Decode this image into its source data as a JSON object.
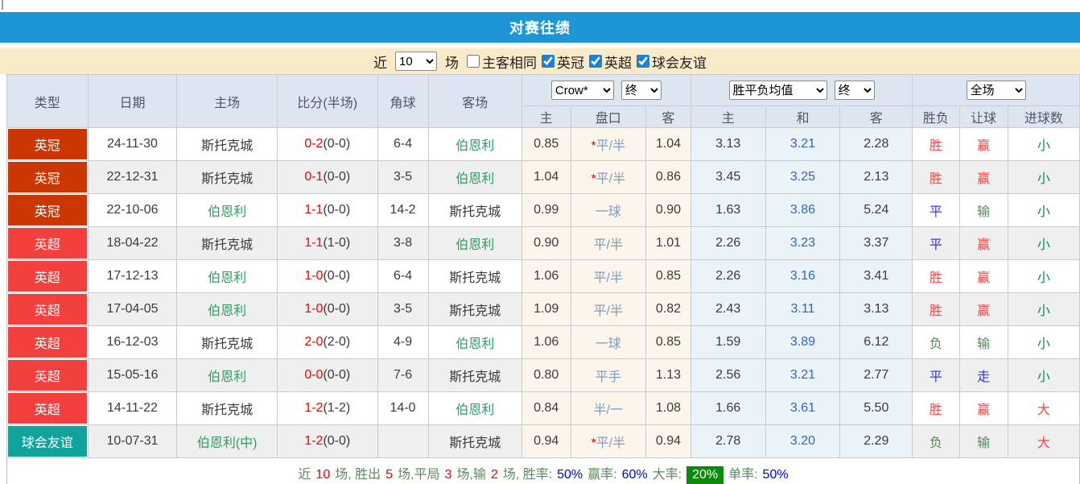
{
  "title_bar": {
    "title": "对赛往绩"
  },
  "filter_bar": {
    "recent_label": "近",
    "recent_count": "10",
    "unit_label": "场",
    "same_venue_label": "主客相同",
    "same_venue_checked": false,
    "leagues": [
      {
        "label": "英冠",
        "checked": true
      },
      {
        "label": "英超",
        "checked": true
      },
      {
        "label": "球会友谊",
        "checked": true
      }
    ]
  },
  "table": {
    "header": {
      "left_cols": [
        "类型",
        "日期",
        "主场",
        "比分(半场)",
        "角球",
        "客场"
      ],
      "company_select": "Crow*",
      "company_state_select": "终",
      "avg_select": "胜平负均值",
      "avg_state_select": "终",
      "scope_select": "全场",
      "sub_cols": [
        "主",
        "盘口",
        "客",
        "主",
        "和",
        "客",
        "胜负",
        "让球",
        "进球数"
      ]
    },
    "rows": [
      {
        "league": "英冠",
        "date": "24-11-30",
        "home": "斯托克城",
        "score": "0-2",
        "half": "(0-0)",
        "corners": "6-4",
        "away": "伯恩利",
        "crow_home": "0.85",
        "star": true,
        "handicap": "平/半",
        "crow_away": "1.04",
        "avg_home": "3.13",
        "avg_draw": "3.21",
        "avg_away": "2.28",
        "outcome": "胜",
        "handicap_result": "赢",
        "goals_result": "小"
      },
      {
        "league": "英冠",
        "date": "22-12-31",
        "home": "斯托克城",
        "score": "0-1",
        "half": "(0-0)",
        "corners": "3-5",
        "away": "伯恩利",
        "crow_home": "1.04",
        "star": true,
        "handicap": "平/半",
        "crow_away": "0.86",
        "avg_home": "3.45",
        "avg_draw": "3.25",
        "avg_away": "2.13",
        "outcome": "胜",
        "handicap_result": "赢",
        "goals_result": "小"
      },
      {
        "league": "英冠",
        "date": "22-10-06",
        "home": "伯恩利",
        "score": "1-1",
        "half": "(0-0)",
        "corners": "14-2",
        "away": "斯托克城",
        "crow_home": "0.99",
        "star": false,
        "handicap": "一球",
        "crow_away": "0.90",
        "avg_home": "1.63",
        "avg_draw": "3.86",
        "avg_away": "5.24",
        "outcome": "平",
        "handicap_result": "输",
        "goals_result": "小"
      },
      {
        "league": "英超",
        "date": "18-04-22",
        "home": "斯托克城",
        "score": "1-1",
        "half": "(1-0)",
        "corners": "3-8",
        "away": "伯恩利",
        "crow_home": "0.90",
        "star": false,
        "handicap": "平/半",
        "crow_away": "1.01",
        "avg_home": "2.26",
        "avg_draw": "3.23",
        "avg_away": "3.37",
        "outcome": "平",
        "handicap_result": "赢",
        "goals_result": "小"
      },
      {
        "league": "英超",
        "date": "17-12-13",
        "home": "伯恩利",
        "score": "1-0",
        "half": "(0-0)",
        "corners": "6-4",
        "away": "斯托克城",
        "crow_home": "1.06",
        "star": false,
        "handicap": "平/半",
        "crow_away": "0.85",
        "avg_home": "2.26",
        "avg_draw": "3.16",
        "avg_away": "3.41",
        "outcome": "胜",
        "handicap_result": "赢",
        "goals_result": "小"
      },
      {
        "league": "英超",
        "date": "17-04-05",
        "home": "伯恩利",
        "score": "1-0",
        "half": "(0-0)",
        "corners": "3-5",
        "away": "斯托克城",
        "crow_home": "1.09",
        "star": false,
        "handicap": "平/半",
        "crow_away": "0.82",
        "avg_home": "2.43",
        "avg_draw": "3.11",
        "avg_away": "3.13",
        "outcome": "胜",
        "handicap_result": "赢",
        "goals_result": "小"
      },
      {
        "league": "英超",
        "date": "16-12-03",
        "home": "斯托克城",
        "score": "2-0",
        "half": "(2-0)",
        "corners": "4-9",
        "away": "伯恩利",
        "crow_home": "1.06",
        "star": false,
        "handicap": "一球",
        "crow_away": "0.85",
        "avg_home": "1.59",
        "avg_draw": "3.89",
        "avg_away": "6.12",
        "outcome": "负",
        "handicap_result": "输",
        "goals_result": "小"
      },
      {
        "league": "英超",
        "date": "15-05-16",
        "home": "伯恩利",
        "score": "0-0",
        "half": "(0-0)",
        "corners": "7-6",
        "away": "斯托克城",
        "crow_home": "0.80",
        "star": false,
        "handicap": "平手",
        "crow_away": "1.13",
        "avg_home": "2.56",
        "avg_draw": "3.21",
        "avg_away": "2.77",
        "outcome": "平",
        "handicap_result": "走",
        "goals_result": "小"
      },
      {
        "league": "英超",
        "date": "14-11-22",
        "home": "斯托克城",
        "score": "1-2",
        "half": "(1-2)",
        "corners": "14-0",
        "away": "伯恩利",
        "crow_home": "0.84",
        "star": false,
        "handicap": "半/一",
        "crow_away": "1.08",
        "avg_home": "1.66",
        "avg_draw": "3.61",
        "avg_away": "5.50",
        "outcome": "胜",
        "handicap_result": "赢",
        "goals_result": "大"
      },
      {
        "league": "球会友谊",
        "date": "10-07-31",
        "home": "伯恩利(中)",
        "score": "1-2",
        "half": "(0-0)",
        "corners": "",
        "away": "斯托克城",
        "crow_home": "0.94",
        "star": true,
        "handicap": "平/半",
        "crow_away": "0.94",
        "avg_home": "2.78",
        "avg_draw": "3.20",
        "avg_away": "2.29",
        "outcome": "负",
        "handicap_result": "输",
        "goals_result": "大"
      }
    ]
  },
  "league_colors": {
    "英冠": "#CB3703",
    "英超": "#F43F3F",
    "球会友谊": "#0FA39C"
  },
  "team_colors": {
    "斯托克城": "#3B3B3B",
    "伯恩利": "#2E9E63",
    "伯恩利(中)": "#2E9E63"
  },
  "result_colors": {
    "胜": "#FE4545",
    "平": "#3535F3",
    "负": "#55885C",
    "赢": "#FE4545",
    "输": "#55885C",
    "走": "#3535F3",
    "大": "#FE4545",
    "小": "#128A60"
  },
  "summary": {
    "seg1": "近",
    "n1": "10",
    "seg2": "场, 胜出",
    "n2": "5",
    "seg3": "场,平局",
    "n3": "3",
    "seg4": "场,输",
    "n4": "2",
    "seg5": "场, 胜率:",
    "r1": "50%",
    "seg6": "赢率:",
    "r2": "60%",
    "seg7": "大率:",
    "badge": "20%",
    "seg8": "单率:",
    "r3": "50%"
  },
  "colors": {
    "title_bar_bg": "#1E96D5",
    "filter_bar_bg": "#FAEBC8",
    "header_bg": "#DCE5F0",
    "header_text": "#4F5866",
    "row_alt_bg": "#EFEFEF",
    "company_cols_bg": "#FBF5EC",
    "avg_cols_bg": "#E9F3F8",
    "score_red": "#FF0000",
    "handicap_text": "#7F9DB9",
    "draw_odds_blue": "#3565C8",
    "summary_label_green": "#5E8A5E",
    "summary_rate_blue": "#0000EE",
    "summary_badge_green": "#0B8A0B",
    "checkbox_accent": "#1E82D2"
  }
}
